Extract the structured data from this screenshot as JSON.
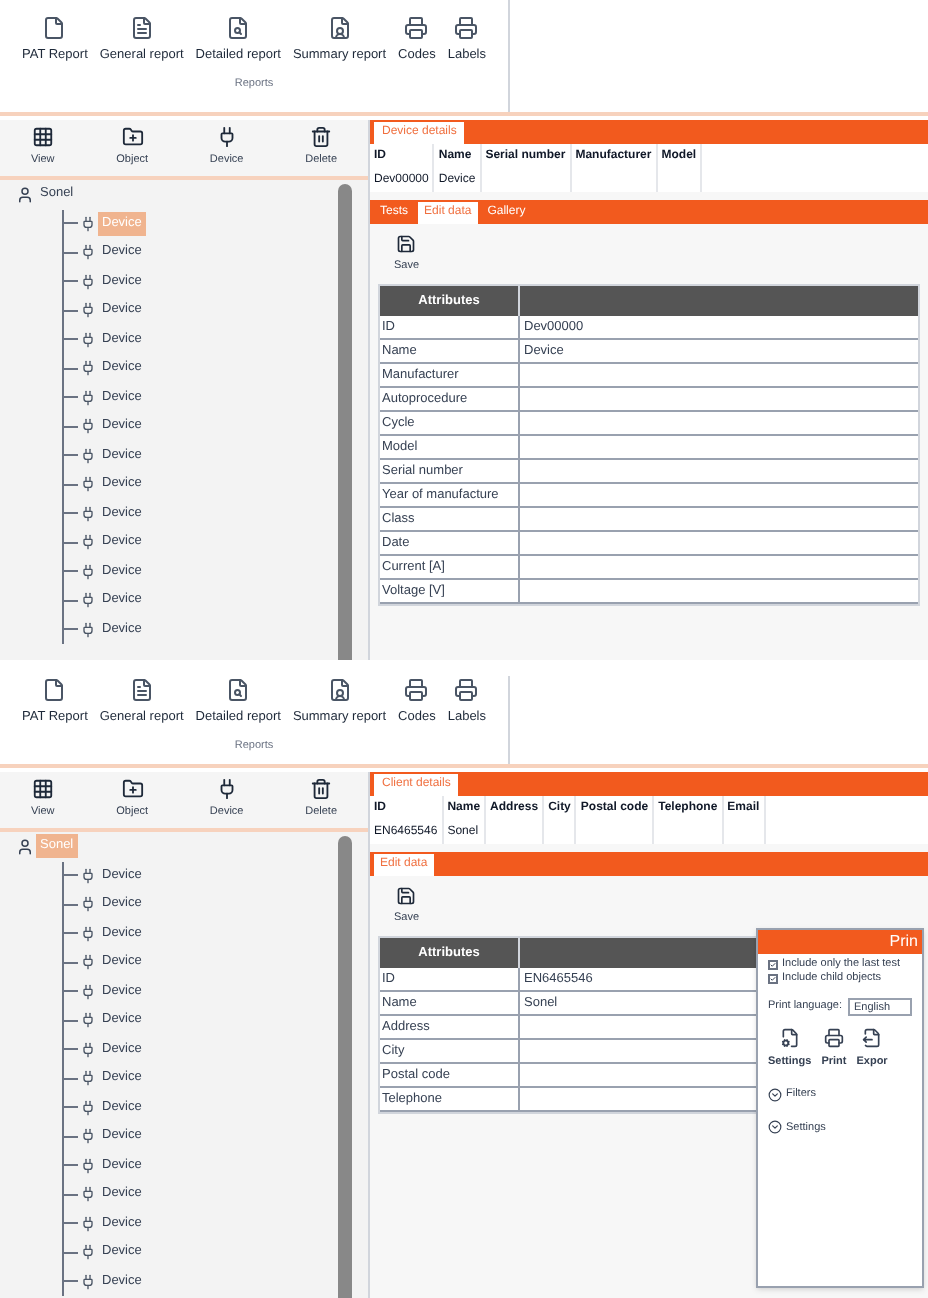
{
  "screens": [
    {
      "ribbon": {
        "buttons": [
          "PAT Report",
          "General report",
          "Detailed report",
          "Summary report",
          "Codes",
          "Labels"
        ],
        "group": "Reports"
      },
      "tree_toolbar": [
        "View",
        "Object",
        "Device",
        "Delete"
      ],
      "tree": {
        "label": "Sonel",
        "selected": false,
        "children": [
          {
            "label": "Device",
            "selected": true
          },
          {
            "label": "Device",
            "selected": false
          },
          {
            "label": "Device",
            "selected": false
          },
          {
            "label": "Device",
            "selected": false
          },
          {
            "label": "Device",
            "selected": false
          },
          {
            "label": "Device",
            "selected": false
          },
          {
            "label": "Device",
            "selected": false
          },
          {
            "label": "Device",
            "selected": false
          },
          {
            "label": "Device",
            "selected": false
          },
          {
            "label": "Device",
            "selected": false
          },
          {
            "label": "Device",
            "selected": false
          },
          {
            "label": "Device",
            "selected": false
          },
          {
            "label": "Device",
            "selected": false
          },
          {
            "label": "Device",
            "selected": false
          },
          {
            "label": "Device",
            "selected": false
          }
        ]
      },
      "details": {
        "tab": "Device details",
        "columns": [
          "ID",
          "Name",
          "Serial number",
          "Manufacturer",
          "Model"
        ],
        "row": [
          "Dev00000",
          "Device"
        ]
      },
      "subtabs": [
        {
          "label": "Tests",
          "selected": false
        },
        {
          "label": "Edit data",
          "selected": true
        },
        {
          "label": "Gallery",
          "selected": false
        }
      ],
      "save": "Save",
      "attributes": {
        "header": "Attributes",
        "rows": [
          [
            "ID",
            "Dev00000"
          ],
          [
            "Name",
            "Device"
          ],
          [
            "Manufacturer",
            ""
          ],
          [
            "Autoprocedure",
            ""
          ],
          [
            "Cycle",
            ""
          ],
          [
            "Model",
            ""
          ],
          [
            "Serial number",
            ""
          ],
          [
            "Year of manufacture",
            ""
          ],
          [
            "Class",
            ""
          ],
          [
            "Date",
            ""
          ],
          [
            "Current [A]",
            ""
          ],
          [
            "Voltage [V]",
            ""
          ]
        ]
      }
    },
    {
      "ribbon": {
        "buttons": [
          "PAT Report",
          "General report",
          "Detailed report",
          "Summary report",
          "Codes",
          "Labels"
        ],
        "group": "Reports"
      },
      "tree_toolbar": [
        "View",
        "Object",
        "Device",
        "Delete"
      ],
      "tree": {
        "label": "Sonel",
        "selected": true,
        "children": [
          {
            "label": "Device",
            "selected": false
          },
          {
            "label": "Device",
            "selected": false
          },
          {
            "label": "Device",
            "selected": false
          },
          {
            "label": "Device",
            "selected": false
          },
          {
            "label": "Device",
            "selected": false
          },
          {
            "label": "Device",
            "selected": false
          },
          {
            "label": "Device",
            "selected": false
          },
          {
            "label": "Device",
            "selected": false
          },
          {
            "label": "Device",
            "selected": false
          },
          {
            "label": "Device",
            "selected": false
          },
          {
            "label": "Device",
            "selected": false
          },
          {
            "label": "Device",
            "selected": false
          },
          {
            "label": "Device",
            "selected": false
          },
          {
            "label": "Device",
            "selected": false
          },
          {
            "label": "Device",
            "selected": false
          }
        ]
      },
      "details": {
        "tab": "Client details",
        "columns": [
          "ID",
          "Name",
          "Address",
          "City",
          "Postal code",
          "Telephone",
          "Email"
        ],
        "row": [
          "EN6465546",
          "Sonel"
        ]
      },
      "subtabs": [
        {
          "label": "Edit data",
          "selected": true
        }
      ],
      "save": "Save",
      "attributes": {
        "header": "Attributes",
        "rows": [
          [
            "ID",
            "EN6465546"
          ],
          [
            "Name",
            "Sonel"
          ],
          [
            "Address",
            ""
          ],
          [
            "City",
            ""
          ],
          [
            "Postal code",
            ""
          ],
          [
            "Telephone",
            ""
          ]
        ]
      },
      "print_dialog": {
        "title": "Prin",
        "options": [
          {
            "label": "Include only the last test",
            "checked": true
          },
          {
            "label": "Include child objects",
            "checked": true
          }
        ],
        "language_label": "Print language:",
        "language": "English",
        "buttons": [
          "Settings",
          "Print",
          "Expor"
        ],
        "sections": [
          {
            "label": "Filters",
            "expanded": false
          },
          {
            "label": "Settings",
            "expanded": false
          }
        ]
      }
    }
  ]
}
